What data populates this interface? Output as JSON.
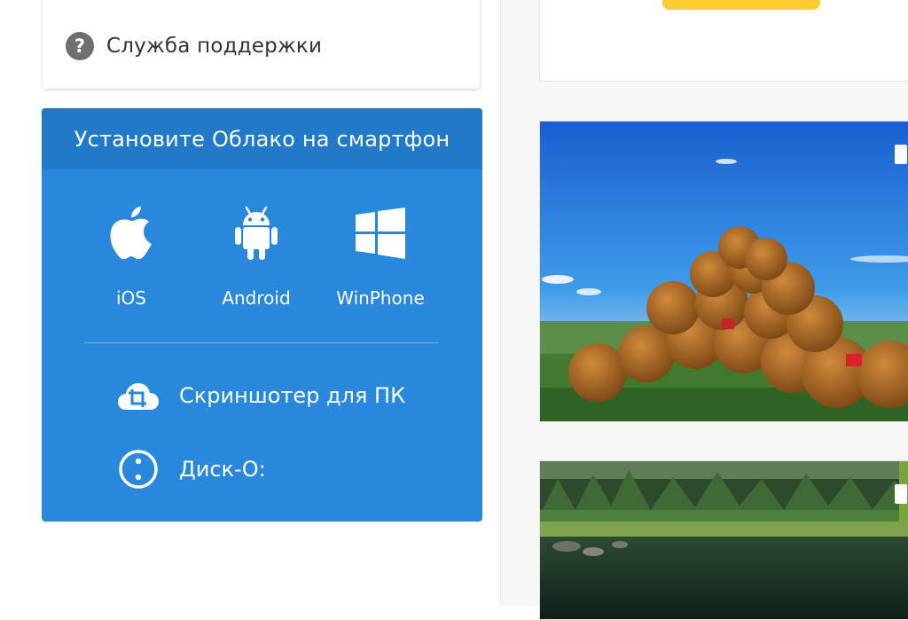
{
  "sidebar": {
    "support": {
      "label": "Служба поддержки",
      "icon": "question-circle-icon"
    },
    "apps": {
      "title": "Установите Облако на смартфон",
      "background": "#2a88dc",
      "header_background": "#2179c7",
      "platforms": [
        {
          "label": "iOS",
          "icon": "apple-icon"
        },
        {
          "label": "Android",
          "icon": "android-icon"
        },
        {
          "label": "WinPhone",
          "icon": "windows-icon"
        }
      ],
      "links": [
        {
          "label": "Скриншотер для ПК",
          "icon": "cloud-crop-icon"
        },
        {
          "label": "Диск-О:",
          "icon": "disk-o-icon"
        }
      ]
    }
  },
  "gallery": {
    "accent": "#ffcc33",
    "photos": [
      {
        "icon": "hay-bales-landscape-photo"
      },
      {
        "icon": "forest-lake-photo"
      }
    ]
  }
}
